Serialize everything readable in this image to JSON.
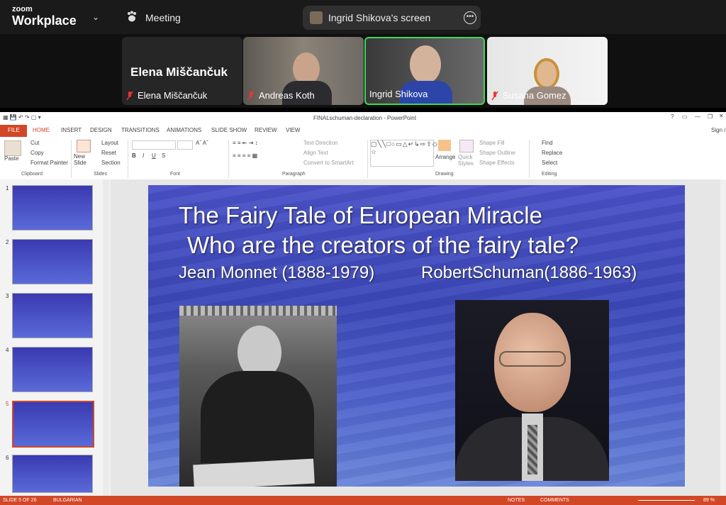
{
  "zoom": {
    "logo_top": "zoom",
    "logo_bottom": "Workplace",
    "meeting_label": "Meeting",
    "share_label": "Ingrid Shikova's screen",
    "participants": [
      {
        "name": "Elena Miščančuk",
        "display": "Elena Miščančuk"
      },
      {
        "name": "Andreas Koth"
      },
      {
        "name": "Ingrid Shikova"
      },
      {
        "name": "Susana Gomez"
      }
    ]
  },
  "ppt": {
    "window_title": "FINALschuman-declaration - PowerPoint",
    "sign_in": "Sign i",
    "tabs": [
      "FILE",
      "HOME",
      "INSERT",
      "DESIGN",
      "TRANSITIONS",
      "ANIMATIONS",
      "SLIDE SHOW",
      "REVIEW",
      "VIEW"
    ],
    "clipboard": {
      "paste": "Paste",
      "cut": "Cut",
      "copy": "Copy",
      "format_painter": "Format Painter",
      "label": "Clipboard"
    },
    "slides_group": {
      "new_slide": "New Slide",
      "layout": "Layout",
      "reset": "Reset",
      "section": "Section",
      "label": "Slides"
    },
    "font_group": {
      "label": "Font"
    },
    "paragraph_group": {
      "text_direction": "Text Direction",
      "align_text": "Align Text",
      "convert": "Convert to SmartArt",
      "label": "Paragraph"
    },
    "drawing_group": {
      "arrange": "Arrange",
      "quick_styles": "Quick Styles",
      "shape_fill": "Shape Fill",
      "shape_outline": "Shape Outline",
      "shape_effects": "Shape Effects",
      "label": "Drawing"
    },
    "editing_group": {
      "find": "Find",
      "replace": "Replace",
      "select": "Select",
      "label": "Editing"
    },
    "slide_numbers": [
      "1",
      "2",
      "3",
      "4",
      "5",
      "6"
    ],
    "slide": {
      "line1": "The Fairy Tale of European Miracle",
      "line2": "Who are the creators of the fairy tale?",
      "line3a": "Jean Monnet (1888-1979)",
      "line3b": "RobertSchuman(1886-1963)"
    },
    "status": {
      "slide_of": "SLIDE 5 OF 26",
      "language": "BULGARIAN",
      "notes": "NOTES",
      "comments": "COMMENTS",
      "zoom": "89 %"
    }
  }
}
